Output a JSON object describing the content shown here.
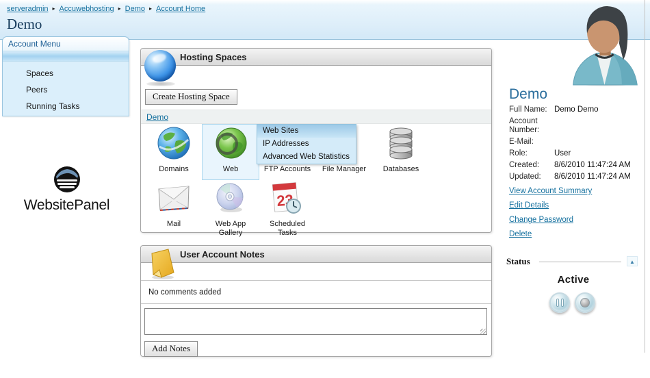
{
  "breadcrumb": {
    "separator": "▸",
    "items": [
      "serveradmin",
      "Accuwebhosting",
      "Demo",
      "Account Home"
    ]
  },
  "page_title": "Demo",
  "sidebar": {
    "menu_title": "Account Menu",
    "items": [
      "Spaces",
      "Peers",
      "Running Tasks"
    ],
    "logo_text": "WebsitePanel"
  },
  "hosting_panel": {
    "title": "Hosting Spaces",
    "create_button_label": "Create Hosting Space",
    "space_link": "Demo",
    "icons_row1": [
      {
        "label": "Domains",
        "icon": "globe-blue-icon"
      },
      {
        "label": "Web",
        "icon": "globe-green-icon"
      },
      {
        "label": "FTP Accounts",
        "icon": "ftp-icon"
      },
      {
        "label": "File Manager",
        "icon": "file-manager-icon"
      },
      {
        "label": "Databases",
        "icon": "database-icon"
      }
    ],
    "icons_row2": [
      {
        "label": "Mail",
        "icon": "envelope-icon"
      },
      {
        "label": "Web App Gallery",
        "icon": "cd-icon"
      },
      {
        "label": "Scheduled Tasks",
        "icon": "calendar-clock-icon"
      }
    ],
    "web_dropdown": {
      "selected": "Web Sites",
      "items": [
        "Web Sites",
        "IP Addresses",
        "Advanced Web Statistics"
      ]
    }
  },
  "notes_panel": {
    "title": "User Account Notes",
    "empty_message": "No comments added",
    "textarea_value": "",
    "add_button_label": "Add Notes"
  },
  "user_panel": {
    "name": "Demo",
    "fields": [
      {
        "label": "Full Name:",
        "value": "Demo Demo"
      },
      {
        "label": "Account Number:",
        "value": ""
      },
      {
        "label": "E-Mail:",
        "value": ""
      },
      {
        "label": "Role:",
        "value": "User"
      },
      {
        "label": "Created:",
        "value": "8/6/2010 11:47:24 AM"
      },
      {
        "label": "Updated:",
        "value": "8/6/2010 11:47:24 AM"
      }
    ],
    "links": [
      "View Account Summary",
      "Edit Details",
      "Change Password",
      "Delete"
    ],
    "status": {
      "label": "Status",
      "collapse_icon": "▲",
      "value": "Active"
    }
  },
  "colors": {
    "link_blue": "#16719f",
    "band_blue": "#dcedf9",
    "selection_blue": "#a9d3ec",
    "name_blue": "#2b6e9d",
    "status_button_teal": "#a9cdda"
  }
}
